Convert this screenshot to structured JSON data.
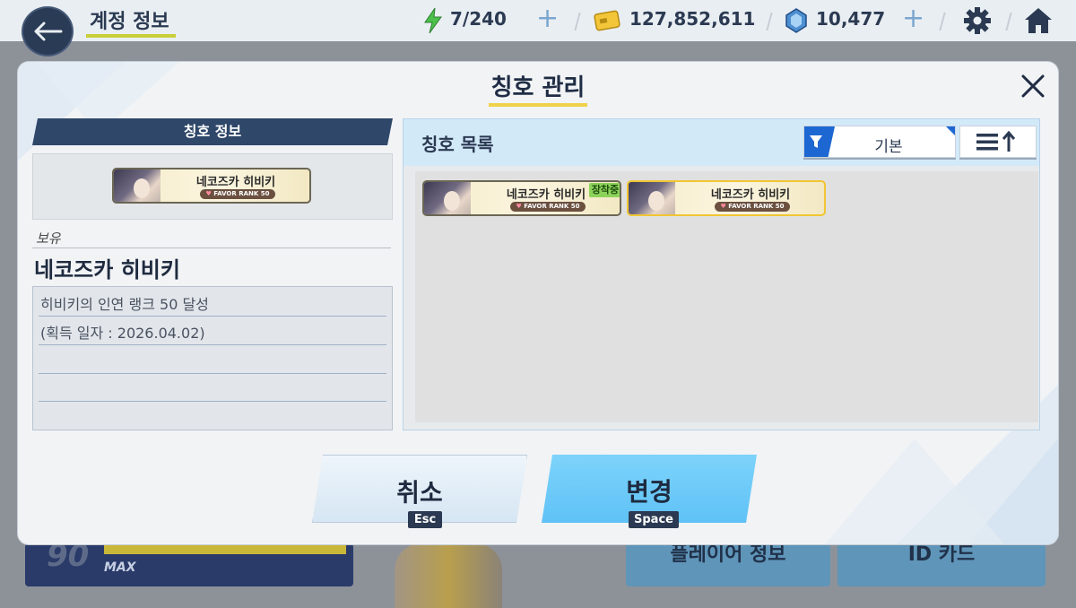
{
  "topbar": {
    "title": "계정 정보",
    "stamina": "7/240",
    "credits": "127,852,611",
    "gems": "10,477"
  },
  "background": {
    "level": "90",
    "level_max": "MAX",
    "player_info_button": "플레이어 정보",
    "id_card_button": "ID 카드"
  },
  "modal": {
    "title": "칭호 관리",
    "left": {
      "header": "칭호 정보",
      "owned_label": "보유",
      "title_name": "네코즈카 히비키",
      "description": "히비키의 인연 랭크 50 달성",
      "acquired": "(획득 일자 : 2026.04.02)"
    },
    "right": {
      "header": "칭호 목록",
      "filter_label": "기본"
    },
    "plates": [
      {
        "name": "네코즈카 히비키",
        "badge": "FAVOR RANK 50",
        "tag": "장착중"
      },
      {
        "name": "네코즈카 히비키",
        "badge": "FAVOR RANK 50"
      }
    ],
    "preview_plate": {
      "name": "네코즈카 히비키",
      "badge": "FAVOR RANK 50"
    },
    "cancel_label": "취소",
    "cancel_key": "Esc",
    "confirm_label": "변경",
    "confirm_key": "Space"
  },
  "colors": {
    "accent": "#5fc2f6",
    "header_navy": "#2f4769",
    "equipped_green": "#8cd35a",
    "selected_gold": "#f1c534"
  },
  "icons": [
    "back-arrow-icon",
    "lightning-icon",
    "credit-card-icon",
    "gem-icon",
    "gear-icon",
    "home-icon",
    "close-icon",
    "filter-icon",
    "sort-icon",
    "heart-icon"
  ]
}
